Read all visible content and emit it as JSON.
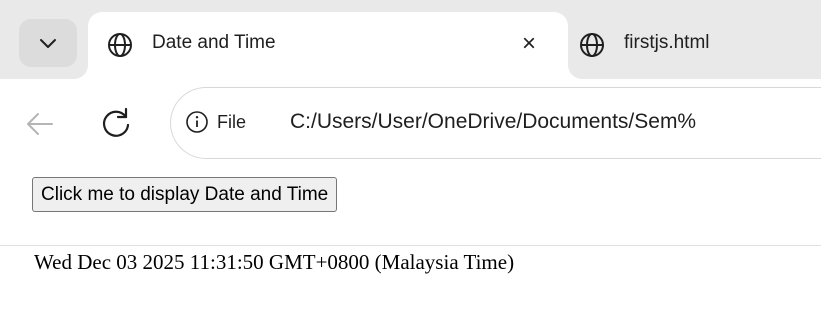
{
  "browser": {
    "tabs": [
      {
        "title": "Date and Time",
        "icon": "globe-icon",
        "active": true
      },
      {
        "title": "firstjs.html",
        "icon": "globe-icon",
        "active": false
      }
    ],
    "tab_close_symbol": "×",
    "site_info_label": "File",
    "url": "C:/Users/User/OneDrive/Documents/Sem%"
  },
  "page": {
    "button_label": "Click me to display Date and Time",
    "date_output": "Wed Dec 03 2025 11:31:50 GMT+0800 (Malaysia Time)"
  },
  "colors": {
    "tabstrip_bg": "#e9e9e9",
    "active_tab_bg": "#ffffff",
    "button_bg": "#efefef",
    "button_border": "#767676"
  }
}
